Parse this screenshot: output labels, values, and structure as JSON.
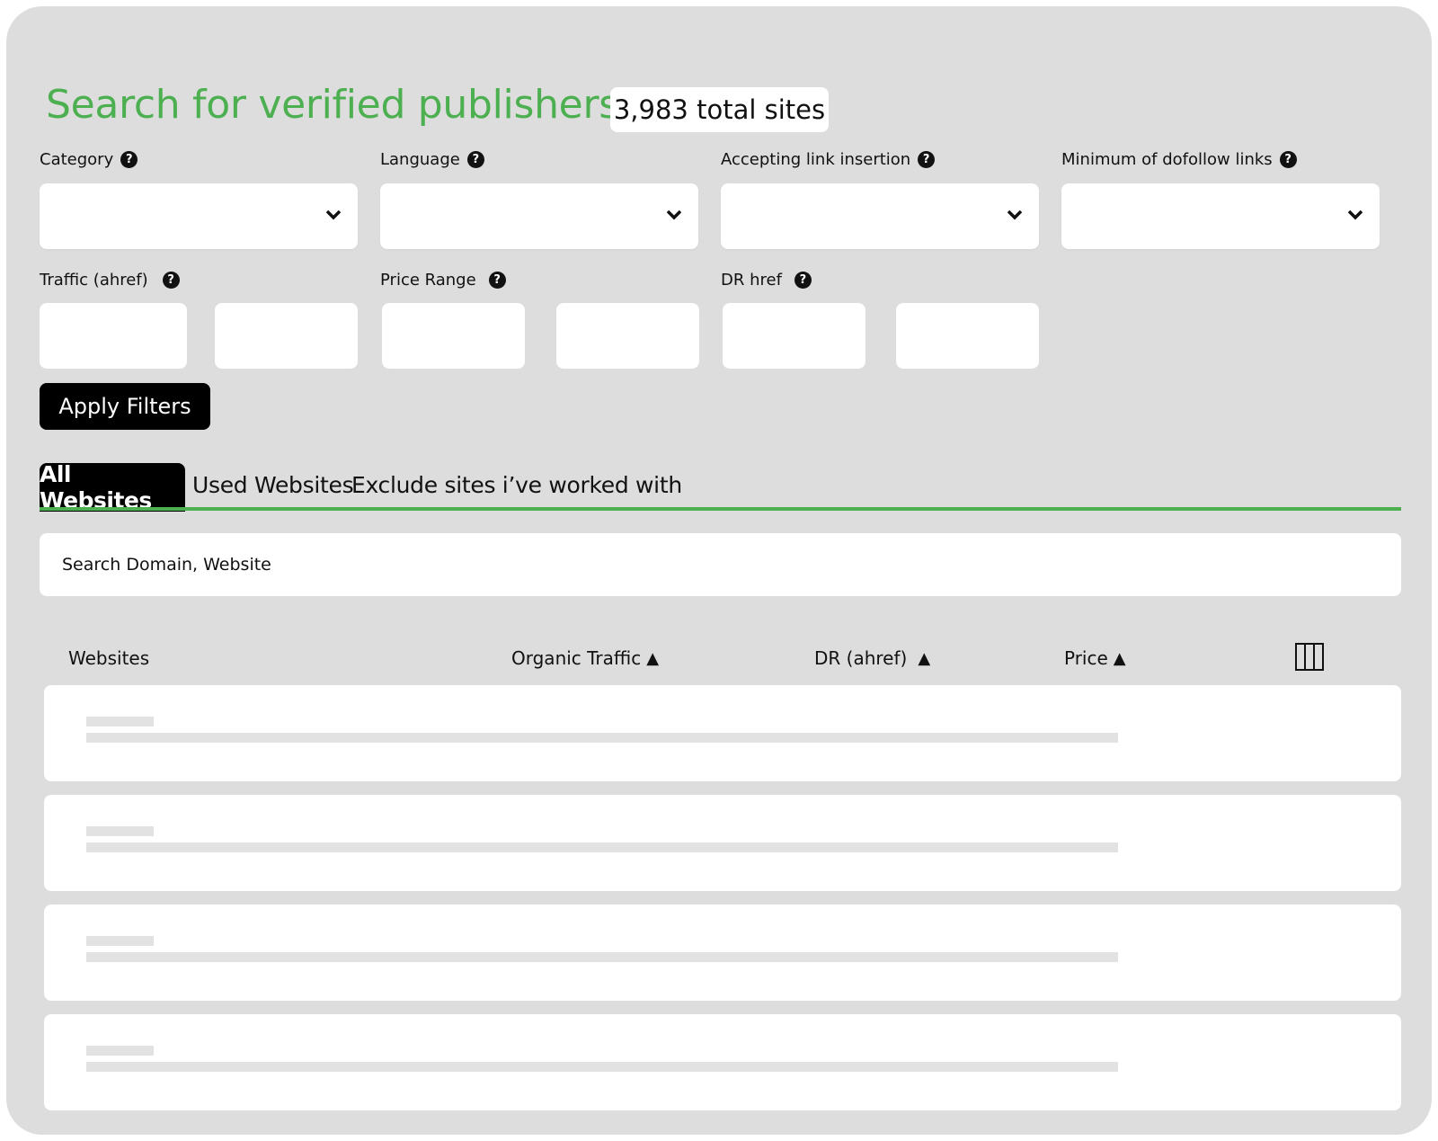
{
  "header": {
    "title": "Search for verified publishers",
    "total_sites": "3,983 total sites"
  },
  "filters": {
    "category": {
      "label": "Category",
      "value": ""
    },
    "language": {
      "label": "Language",
      "value": ""
    },
    "link_insertion": {
      "label": "Accepting link insertion",
      "value": ""
    },
    "dofollow": {
      "label": "Minimum of dofollow links",
      "value": ""
    },
    "traffic": {
      "label": "Traffic (ahref)",
      "min": "",
      "max": ""
    },
    "price": {
      "label": "Price Range",
      "min": "",
      "max": ""
    },
    "dr": {
      "label": "DR href",
      "min": "",
      "max": ""
    },
    "help_glyph": "?",
    "apply_label": "Apply Filters"
  },
  "tabs": [
    {
      "label": "All Websites",
      "active": true
    },
    {
      "label": "Used Websites",
      "active": false
    },
    {
      "label": "Exclude sites i’ve worked with",
      "active": false
    }
  ],
  "search": {
    "text": "Search Domain, Website"
  },
  "table": {
    "columns": [
      {
        "label": "Websites",
        "sortable": false
      },
      {
        "label": "Organic Traffic",
        "sortable": true
      },
      {
        "label": "DR (ahref)",
        "sortable": true
      },
      {
        "label": "Price",
        "sortable": true
      }
    ],
    "sort_glyph": "▲",
    "loading_rows": 4
  },
  "colors": {
    "accent": "#4caf50",
    "panel_bg": "#dddddd",
    "button_bg": "#000000"
  }
}
